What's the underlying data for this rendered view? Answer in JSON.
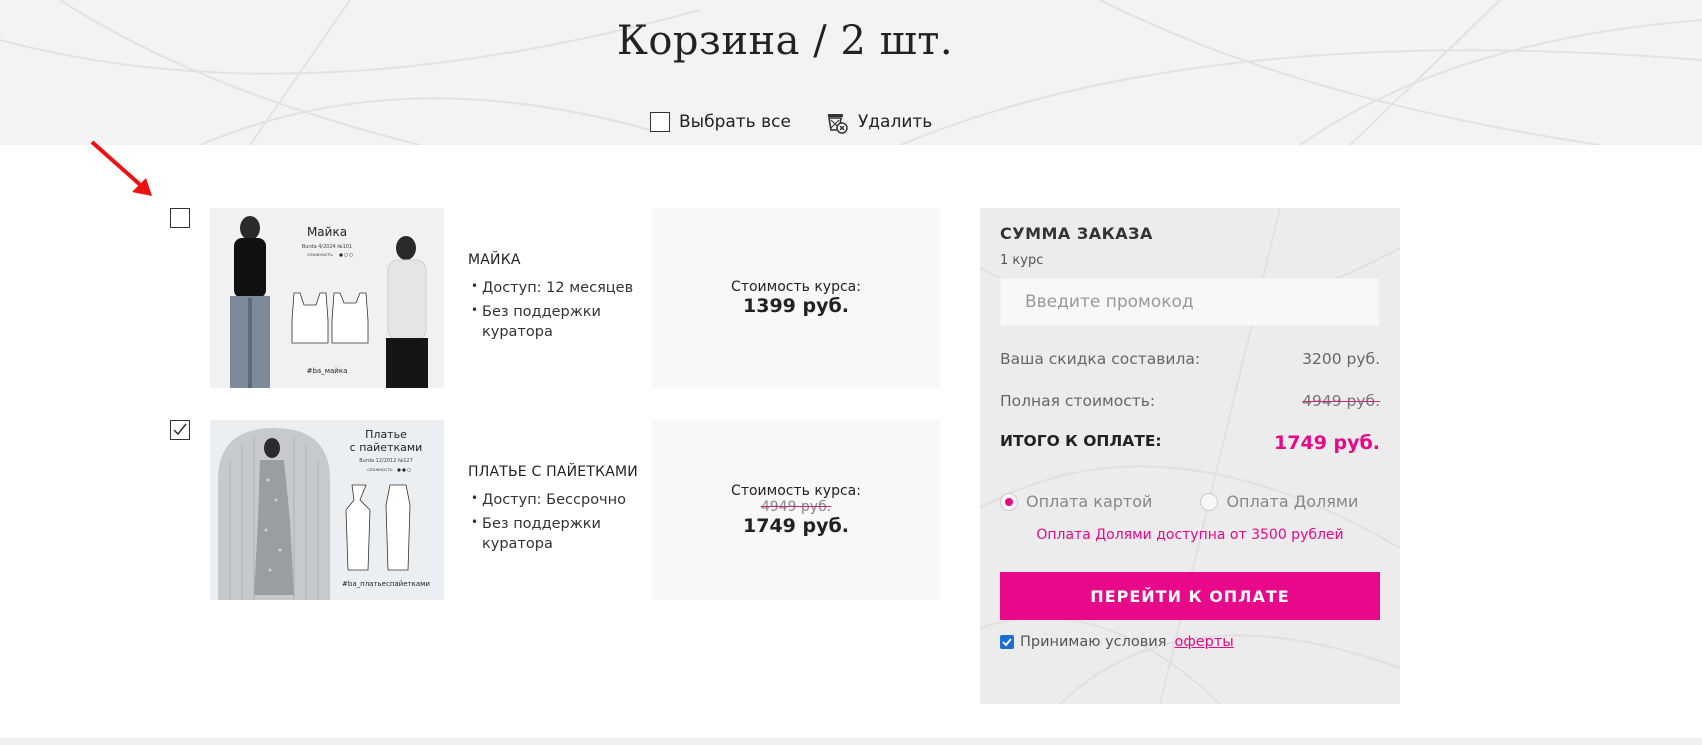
{
  "header": {
    "title": "Корзина / 2 шт.",
    "select_all_label": "Выбрать все",
    "delete_label": "Удалить"
  },
  "items": [
    {
      "name": "МАЙКА",
      "checked": false,
      "thumb_title": "Майка",
      "thumb_sub": "Burda 4/2024 №101",
      "thumb_level": "сложность",
      "thumb_tag": "#ba_майка",
      "bullets": [
        "Доступ: 12 месяцев",
        "Без поддержки куратора"
      ],
      "price_label": "Стоимость курса:",
      "old_price": "",
      "price": "1399 руб."
    },
    {
      "name": "ПЛАТЬЕ С ПАЙЕТКАМИ",
      "checked": true,
      "thumb_title": "Платье с пайетками",
      "thumb_sub": "Burda 12/2012 №127",
      "thumb_level": "сложность",
      "thumb_tag": "#ba_платьеспайетками",
      "bullets": [
        "Доступ: Бессрочно",
        "Без поддержки куратора"
      ],
      "price_label": "Стоимость курса:",
      "old_price": "4949 руб.",
      "price": "1749 руб."
    }
  ],
  "summary": {
    "title": "СУММА ЗАКАЗА",
    "count": "1 курс",
    "promo_placeholder": "Введите промокод",
    "discount_label": "Ваша скидка составила:",
    "discount_value": "3200 руб.",
    "full_label": "Полная стоимость:",
    "full_value": "4949 руб.",
    "total_label": "ИТОГО К ОПЛАТЕ:",
    "total_value": "1749 руб.",
    "pay_card": "Оплата картой",
    "pay_dolyami": "Оплата Долями",
    "selected_payment": "Оплата картой",
    "dolyami_note": "Оплата Долями доступна от 3500 рублей",
    "pay_button": "ПЕРЕЙТИ К ОПЛАТЕ",
    "terms_text": "Принимаю условия",
    "terms_link": "оферты",
    "terms_checked": true
  },
  "colors": {
    "accent": "#e8088a",
    "annotation_arrow": "#ee1111"
  }
}
